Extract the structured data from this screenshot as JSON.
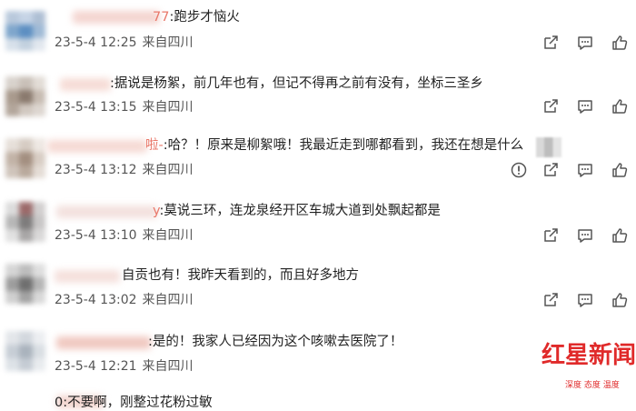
{
  "comments": [
    {
      "name_suffix": "77",
      "text": ":跑步才恼火",
      "date": "23-5-4 12:25",
      "location": "来自四川"
    },
    {
      "name_suffix": "",
      "text": ":据说是杨絮，前几年也有，但记不得再之前有没有，坐标三圣乡",
      "date": "23-5-4 13:15",
      "location": "来自四川"
    },
    {
      "name_suffix": "啦-",
      "text": ":哈？！原来是柳絮哦！我最近走到哪都看到，我还在想是什么",
      "date": "23-5-4 13:12",
      "location": "来自四川"
    },
    {
      "name_suffix": "y",
      "text": ":莫说三环，连龙泉经开区车城大道到处飘起都是",
      "date": "23-5-4 13:10",
      "location": "来自四川"
    },
    {
      "name_suffix": "",
      "text": "自贡也有！我昨天看到的，而且好多地方",
      "date": "23-5-4 13:02",
      "location": "来自四川"
    },
    {
      "name_suffix": "",
      "text": ":是的！我家人已经因为这个咳嗽去医院了！",
      "date": "23-5-4 12:21",
      "location": "来自四川"
    }
  ],
  "partial_comment": {
    "text": "0:不要啊，刚整过花粉过敏"
  },
  "icons": {
    "share": "share-icon",
    "comment": "comment-icon",
    "like": "thumbs-up-icon",
    "report": "report-icon"
  },
  "watermark": {
    "main": "红星新闻",
    "sub": "深度 态度 温度",
    "color": "#e02a2a"
  },
  "colors": {
    "username": "#e9786a",
    "meta": "#555555",
    "icon": "#555555"
  }
}
